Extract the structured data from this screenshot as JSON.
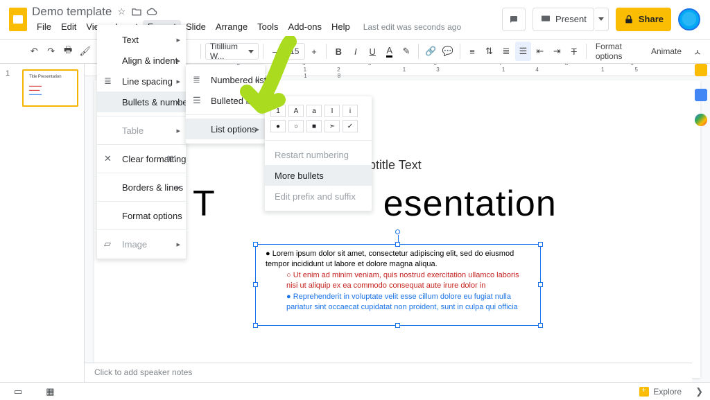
{
  "doc": {
    "name": "Demo template",
    "last_edit": "Last edit was seconds ago"
  },
  "menubar": {
    "file": "File",
    "edit": "Edit",
    "view": "View",
    "insert": "Insert",
    "format": "Format",
    "slide": "Slide",
    "arrange": "Arrange",
    "tools": "Tools",
    "addons": "Add-ons",
    "help": "Help"
  },
  "topbuttons": {
    "present": "Present",
    "share": "Share"
  },
  "toolbar": {
    "font": "Titillium W...",
    "fontsize": "15",
    "formatoptions": "Format options",
    "animate": "Animate"
  },
  "format_menu": {
    "text": "Text",
    "align": "Align & indent",
    "linespacing": "Line spacing",
    "bullets": "Bullets & numbering",
    "table": "Table",
    "clear": "Clear formatting",
    "clear_short": "⌘\\",
    "borders": "Borders & lines",
    "formatoptions": "Format options",
    "image": "Image"
  },
  "bullets_submenu": {
    "numbered": "Numbered list",
    "bulleted": "Bulleted list",
    "listoptions": "List options"
  },
  "listoptions_submenu": {
    "row1": [
      "1",
      "A",
      "a",
      "I",
      "i"
    ],
    "row2": [
      "●",
      "○",
      "■",
      "➣",
      "✓"
    ],
    "restart": "Restart numbering",
    "more": "More bullets",
    "editprefix": "Edit prefix and suffix"
  },
  "slide": {
    "subtitle": "btitle Text",
    "title_left": "T",
    "title_right": "esentation",
    "bullet1": "Lorem ipsum dolor sit amet, consectetur adipiscing elit, sed do eiusmod tempor incididunt ut labore et dolore magna aliqua.",
    "bullet2": "Ut enim ad minim veniam, quis nostrud exercitation ullamco laboris nisi ut aliquip ex ea commodo consequat aute irure dolor in",
    "bullet3": "Reprehenderit in voluptate velit esse cillum dolore eu fugiat nulla pariatur sint occaecat cupidatat non proident, sunt in culpa qui officia"
  },
  "thumb": {
    "num": "1",
    "title": "Title Presentation"
  },
  "notes": {
    "placeholder": "Click to add speaker notes"
  },
  "status": {
    "explore": "Explore"
  },
  "ruler": "1 2 3 4 5 6 7 8 9 10 11 12 13 14 15 16 17 18"
}
